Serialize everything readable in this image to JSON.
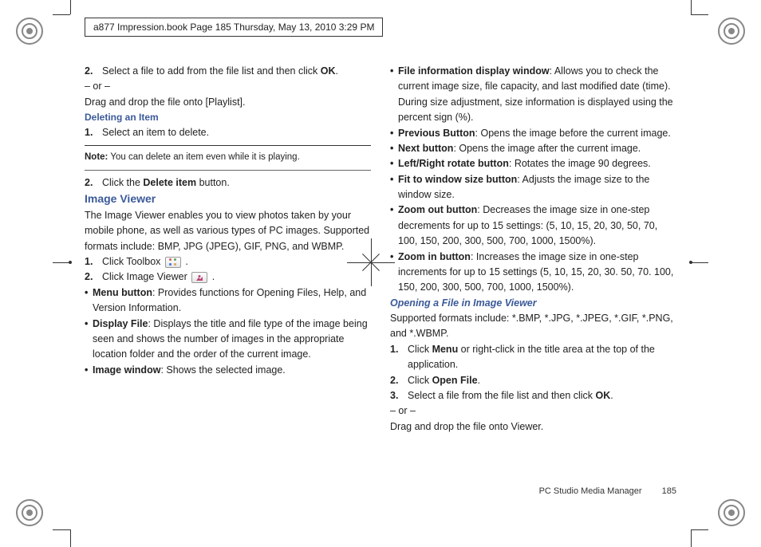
{
  "header": {
    "running_head": "a877 Impression.book  Page 185  Thursday, May 13, 2010  3:29 PM"
  },
  "left": {
    "step2a": "Select a file to add from the file list and then click ",
    "step2a_bold": "OK",
    "step2a_end": ".",
    "or": "– or –",
    "drag": "Drag and drop the file onto [Playlist].",
    "h_delete": "Deleting an Item",
    "del1": "Select an item to delete.",
    "note_label": "Note:",
    "note_text": " You can delete an item even while it is playing.",
    "del2a": "Click the ",
    "del2b": "Delete item",
    "del2c": " button.",
    "h_image": "Image Viewer",
    "image_intro": "The Image Viewer enables you to view photos taken by your mobile phone, as well as various types of PC images. Supported formats include: BMP, JPG (JPEG), GIF, PNG, and WBMP.",
    "iv1": "Click Toolbox ",
    "iv1_end": " .",
    "iv2": "Click Image Viewer ",
    "iv2_end": " .",
    "b_menu_label": "Menu button",
    "b_menu_text": ": Provides functions for Opening Files, Help, and Version Information.",
    "b_display_label": "Display File",
    "b_display_text": ": Displays the title and file type of the image being seen and shows the number of images in the appropriate location folder and the order of the current image.",
    "b_imgwin_label": "Image window",
    "b_imgwin_text": ": Shows the selected image."
  },
  "right": {
    "b_fileinfo_label": "File information display window",
    "b_fileinfo_text": ": Allows you to check the current image size, file capacity, and last modified date (time). During size adjustment, size information is displayed using the percent sign (%).",
    "b_prev_label": "Previous Button",
    "b_prev_text": ": Opens the image before the current image.",
    "b_next_label": "Next button",
    "b_next_text": ": Opens the image after the current image.",
    "b_rotate_label": "Left/Right rotate button",
    "b_rotate_text": ": Rotates the image 90 degrees.",
    "b_fit_label": "Fit to window size button",
    "b_fit_text": ": Adjusts the image size to the window size.",
    "b_zoomout_label": "Zoom out button",
    "b_zoomout_text": ": Decreases the image size in one-step decrements for up to 15 settings: (5, 10, 15, 20, 30, 50, 70, 100, 150, 200, 300, 500, 700, 1000, 1500%).",
    "b_zoomin_label": "Zoom in button",
    "b_zoomin_text": ": Increases the image size in one-step increments for up to 15 settings (5, 10, 15, 20, 30. 50, 70. 100, 150, 200, 300, 500, 700, 1000, 1500%).",
    "h_open": "Opening a File in Image Viewer",
    "open_intro": "Supported formats include: *.BMP, *.JPG, *.JPEG, *.GIF, *.PNG, and *.WBMP.",
    "o1a": "Click ",
    "o1b": "Menu",
    "o1c": " or right-click in the title area at the top of the application.",
    "o2a": "Click ",
    "o2b": "Open File",
    "o2c": ".",
    "o3a": "Select a file from the file list and then click ",
    "o3b": "OK",
    "o3c": ".",
    "or": "– or –",
    "drag": "Drag and drop the file onto Viewer."
  },
  "footer": {
    "section": "PC Studio Media Manager",
    "page": "185"
  },
  "nums": {
    "n1": "1.",
    "n2": "2.",
    "n3": "3."
  }
}
